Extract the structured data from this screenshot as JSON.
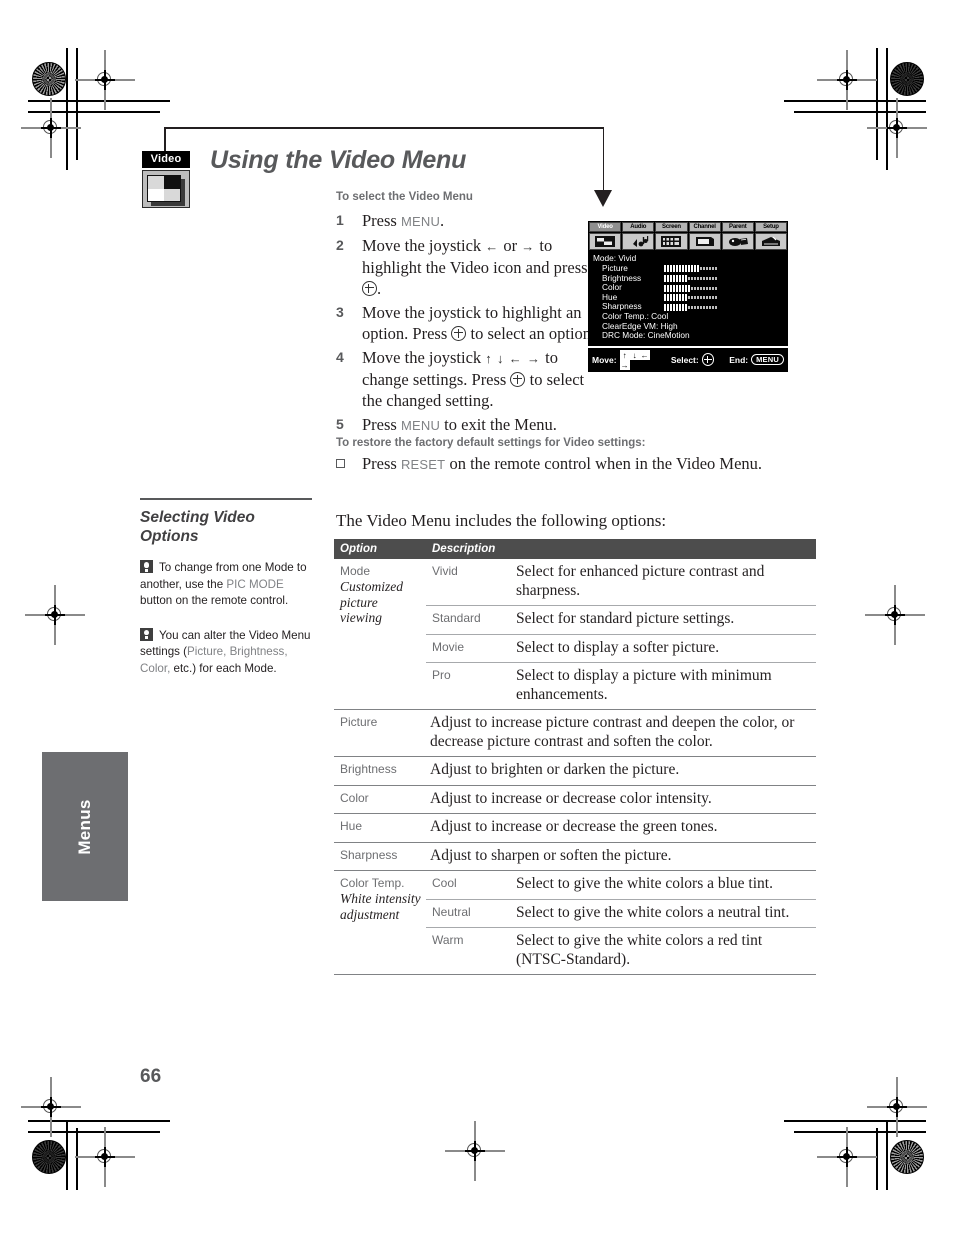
{
  "document": {
    "page_number": "66",
    "side_tab": "Menus",
    "title": "Using the Video Menu",
    "badge_label": "Video"
  },
  "procedure": {
    "heading": "To select the Video Menu",
    "steps": [
      {
        "num": "1",
        "parts": [
          {
            "t": "text",
            "v": "Press "
          },
          {
            "t": "kw",
            "v": "MENU"
          },
          {
            "t": "text",
            "v": "."
          }
        ]
      },
      {
        "num": "2",
        "parts": [
          {
            "t": "text",
            "v": "Move the joystick "
          },
          {
            "t": "joy",
            "v": "←"
          },
          {
            "t": "text",
            "v": " or "
          },
          {
            "t": "joy",
            "v": "→"
          },
          {
            "t": "text",
            "v": " to highlight the Video icon and press "
          },
          {
            "t": "sel",
            "v": ""
          },
          {
            "t": "text",
            "v": "."
          }
        ]
      },
      {
        "num": "3",
        "parts": [
          {
            "t": "text",
            "v": "Move the joystick to highlight an option. Press "
          },
          {
            "t": "sel",
            "v": ""
          },
          {
            "t": "text",
            "v": " to select an option."
          }
        ]
      },
      {
        "num": "4",
        "parts": [
          {
            "t": "text",
            "v": "Move the joystick "
          },
          {
            "t": "joy",
            "v": "↑ ↓ ← →"
          },
          {
            "t": "text",
            "v": " to change settings. Press "
          },
          {
            "t": "sel",
            "v": ""
          },
          {
            "t": "text",
            "v": " to select the changed setting."
          }
        ]
      },
      {
        "num": "5",
        "parts": [
          {
            "t": "text",
            "v": "Press "
          },
          {
            "t": "kw",
            "v": "MENU"
          },
          {
            "t": "text",
            "v": " to exit the Menu."
          }
        ]
      }
    ]
  },
  "restore": {
    "heading": "To restore the factory default settings for Video settings:",
    "bullet_text_before": "Press ",
    "bullet_keyword": "RESET",
    "bullet_text_after": " on the remote control when in the Video Menu."
  },
  "osd": {
    "tabs": [
      {
        "label": "Video",
        "icon": "video-tab-icon",
        "selected": true
      },
      {
        "label": "Audio",
        "icon": "audio-tab-icon",
        "selected": false
      },
      {
        "label": "Screen",
        "icon": "screen-tab-icon",
        "selected": false
      },
      {
        "label": "Channel",
        "icon": "channel-tab-icon",
        "selected": false
      },
      {
        "label": "Parent",
        "icon": "parent-tab-icon",
        "selected": false
      },
      {
        "label": "Setup",
        "icon": "setup-tab-icon",
        "selected": false
      }
    ],
    "mode_line": "Mode: Vivid",
    "sliders": [
      {
        "label": "Picture",
        "filled": 12,
        "total": 18
      },
      {
        "label": "Brightness",
        "filled": 8,
        "total": 18
      },
      {
        "label": "Color",
        "filled": 9,
        "total": 18
      },
      {
        "label": "Hue",
        "filled": 8,
        "total": 18
      },
      {
        "label": "Sharpness",
        "filled": 8,
        "total": 18
      }
    ],
    "text_rows": [
      "Color Temp.: Cool",
      "ClearEdge VM: High",
      "DRC Mode: CineMotion"
    ],
    "footer": {
      "move_label": "Move:",
      "keys": [
        "↑",
        "↓",
        "←",
        "→"
      ],
      "select_label": "Select:",
      "end_label": "End:",
      "end_key": "MENU"
    }
  },
  "left_column": {
    "heading": "Selecting Video Options",
    "tips": [
      {
        "icon": "tip-bulb-icon",
        "segments": [
          {
            "t": "text",
            "v": " To change from one Mode to another, use the "
          },
          {
            "t": "gray",
            "v": "PIC MODE"
          },
          {
            "t": "text",
            "v": " button on the remote control."
          }
        ]
      },
      {
        "icon": "tip-bulb-icon",
        "segments": [
          {
            "t": "text",
            "v": " You can alter the Video Menu settings ("
          },
          {
            "t": "gray",
            "v": "Picture, Brightness, Color,"
          },
          {
            "t": "text",
            "v": " etc.) for each Mode."
          }
        ]
      }
    ]
  },
  "table": {
    "intro": "The Video Menu includes the following options:",
    "headers": [
      "Option",
      "Description"
    ],
    "rows": [
      {
        "option": "Mode",
        "option_italic": "Customized picture viewing",
        "option_rowspan": 4,
        "sub": "Vivid",
        "desc": "Select for enhanced picture contrast and sharpness.",
        "group_start": true
      },
      {
        "sub": "Standard",
        "desc": "Select for standard picture settings."
      },
      {
        "sub": "Movie",
        "desc": "Select to display a softer picture."
      },
      {
        "sub": "Pro",
        "desc": "Select to display a picture with minimum enhancements."
      },
      {
        "option": "Picture",
        "option_italic": "",
        "option_rowspan": 1,
        "sub": "",
        "desc": "Adjust to increase picture contrast and deepen the color, or decrease picture contrast and soften the color.",
        "group_start": true,
        "span_desc": true
      },
      {
        "option": "Brightness",
        "option_italic": "",
        "option_rowspan": 1,
        "sub": "",
        "desc": "Adjust to brighten or darken the picture.",
        "group_start": true,
        "span_desc": true
      },
      {
        "option": "Color",
        "option_italic": "",
        "option_rowspan": 1,
        "sub": "",
        "desc": "Adjust to increase or decrease color intensity.",
        "group_start": true,
        "span_desc": true
      },
      {
        "option": "Hue",
        "option_italic": "",
        "option_rowspan": 1,
        "sub": "",
        "desc": "Adjust to increase or decrease the green tones.",
        "group_start": true,
        "span_desc": true
      },
      {
        "option": "Sharpness",
        "option_italic": "",
        "option_rowspan": 1,
        "sub": "",
        "desc": "Adjust to sharpen or soften the picture.",
        "group_start": true,
        "span_desc": true
      },
      {
        "option": "Color Temp.",
        "option_italic": "White intensity adjustment",
        "option_rowspan": 3,
        "sub": "Cool",
        "desc": "Select to give the white colors a blue tint.",
        "group_start": true
      },
      {
        "sub": "Neutral",
        "desc": "Select to give the white colors a neutral tint."
      },
      {
        "sub": "Warm",
        "desc": "Select to give the white colors a red tint (NTSC-Standard)."
      }
    ]
  },
  "colors": {
    "table_header_bg": "#4d4d4d",
    "title_gray": "#58595b",
    "tab_gray": "#6d6e71",
    "keyword_gray": "#808285",
    "rule_gray": "#a7a9ac"
  }
}
